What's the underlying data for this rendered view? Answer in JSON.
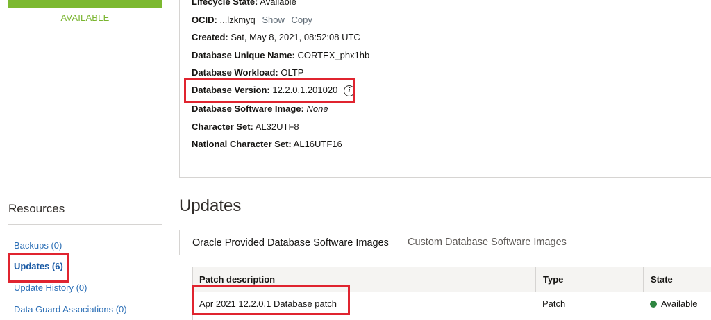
{
  "left_panel": {
    "status": "AVAILABLE",
    "resources_title": "Resources",
    "resources": [
      {
        "label": "Backups (0)",
        "active": false
      },
      {
        "label": "Updates (6)",
        "active": true
      },
      {
        "label": "Update History (0)",
        "active": false
      },
      {
        "label": "Data Guard Associations (0)",
        "active": false
      }
    ]
  },
  "info": {
    "lifecycle": {
      "key": "Lifecycle State:",
      "value": "Available"
    },
    "ocid": {
      "key": "OCID:",
      "value": "...lzkmyq",
      "show": "Show",
      "copy": "Copy"
    },
    "created": {
      "key": "Created:",
      "value": "Sat, May 8, 2021, 08:52:08 UTC"
    },
    "unique_name": {
      "key": "Database Unique Name:",
      "value": "CORTEX_phx1hb"
    },
    "workload": {
      "key": "Database Workload:",
      "value": "OLTP"
    },
    "version": {
      "key": "Database Version:",
      "value": "12.2.0.1.201020",
      "icon": "i"
    },
    "software_image": {
      "key": "Database Software Image:",
      "value": "None"
    },
    "charset": {
      "key": "Character Set:",
      "value": "AL32UTF8"
    },
    "ncharset": {
      "key": "National Character Set:",
      "value": "AL16UTF16"
    }
  },
  "updates": {
    "title": "Updates",
    "tabs": [
      "Oracle Provided Database Software Images",
      "Custom Database Software Images"
    ],
    "table": {
      "headers": [
        "Patch description",
        "Type",
        "State"
      ],
      "rows": [
        {
          "description": "Apr 2021 12.2.0.1 Database patch",
          "type": "Patch",
          "state": "Available"
        }
      ]
    }
  },
  "colors": {
    "available_green": "#7cb930",
    "link_blue": "#2c6fb6",
    "highlight_red": "#e0242f",
    "state_dot_green": "#2e8540"
  }
}
